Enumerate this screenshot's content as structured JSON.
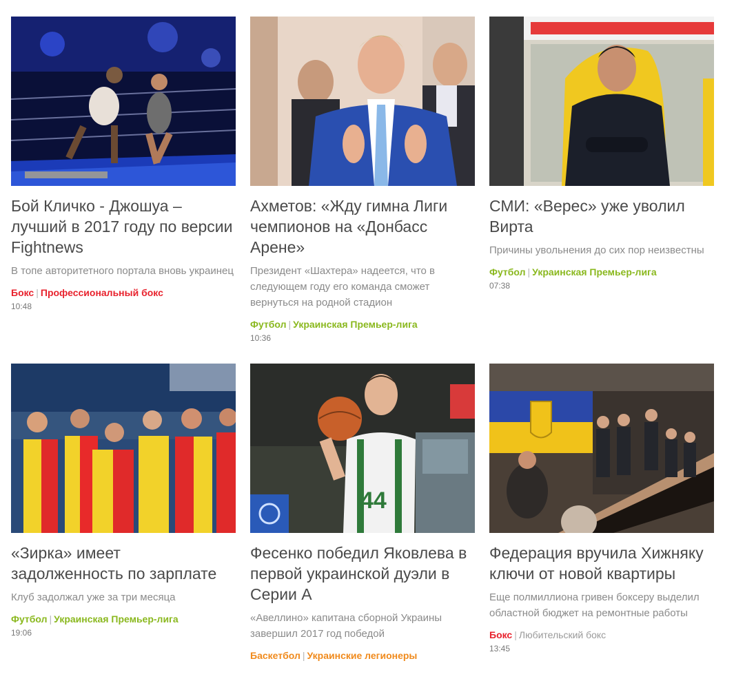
{
  "articles": [
    {
      "title": "Бой Кличко - Джошуа – лучший в 2017 году по версии Fightnews",
      "lead": "В топе авторитетного портала вновь украинец",
      "tags": [
        "Бокс",
        "Профессиональный бокс"
      ],
      "tag_color": "#e8212c",
      "time": "10:48",
      "image": "boxing-ring-photo"
    },
    {
      "title": "Ахметов: «Жду гимна Лиги чемпионов на «Донбасс Арене»",
      "lead": "Президент «Шахтера» надеется, что в следующем году его команда сможет вернуться на родной стадион",
      "tags": [
        "Футбол",
        "Украинская Премьер-лига"
      ],
      "tag_color": "#8ab81e",
      "time": "10:36",
      "image": "man-clapping-photo"
    },
    {
      "title": "СМИ: «Верес» уже уволил Вирта",
      "lead": "Причины увольнения до сих пор неизвестны",
      "tags": [
        "Футбол",
        "Украинская Премьер-лига"
      ],
      "tag_color": "#8ab81e",
      "time": "07:38",
      "image": "coach-bench-photo"
    },
    {
      "title": "«Зирка» имеет задолженность по зарплате",
      "lead": "Клуб задолжал уже за три месяца",
      "tags": [
        "Футбол",
        "Украинская Премьер-лига"
      ],
      "tag_color": "#8ab81e",
      "time": "19:06",
      "image": "football-team-photo"
    },
    {
      "title": "Фесенко победил Яковлева в первой украинской дуэли в Серии А",
      "lead": "«Авеллино» капитана сборной Украины завершил 2017 год победой",
      "tags": [
        "Баскетбол",
        "Украинские легионеры"
      ],
      "tag_color": "#f08a1c",
      "time": "",
      "image": "basketball-player-photo"
    },
    {
      "title": "Федерация вручила Хижняку ключи от новой квартиры",
      "lead": "Еще полмиллиона гривен боксеру выделил областной бюджет на ремонтные работы",
      "tags": [
        "Бокс",
        "Любительский бокс"
      ],
      "tag_color": "#e8212c",
      "time": "13:45",
      "image": "ceremony-room-photo"
    }
  ]
}
